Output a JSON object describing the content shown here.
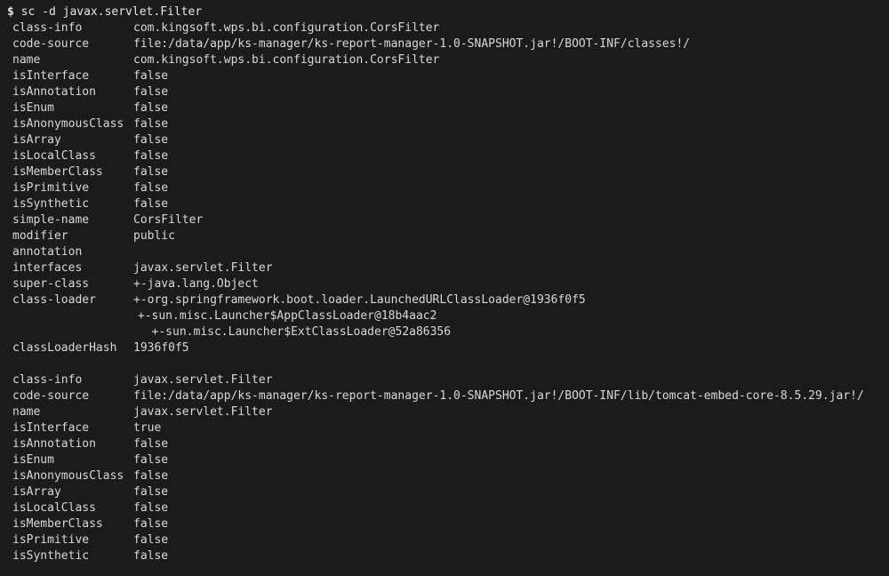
{
  "terminal": {
    "background_color": "#1b1b1b",
    "foreground_color": "#d9d9d9",
    "ghost_line": "                                      ",
    "prompt": {
      "sigil": "$",
      "command": " sc -d javax.servlet.Filter"
    },
    "blocks": [
      {
        "name": "corsfilter-block",
        "rows": [
          {
            "key": "class-info",
            "value": "com.kingsoft.wps.bi.configuration.CorsFilter"
          },
          {
            "key": "code-source",
            "value": "file:/data/app/ks-manager/ks-report-manager-1.0-SNAPSHOT.jar!/BOOT-INF/classes!/"
          },
          {
            "key": "name",
            "value": "com.kingsoft.wps.bi.configuration.CorsFilter"
          },
          {
            "key": "isInterface",
            "value": "false"
          },
          {
            "key": "isAnnotation",
            "value": "false"
          },
          {
            "key": "isEnum",
            "value": "false"
          },
          {
            "key": "isAnonymousClass",
            "value": "false"
          },
          {
            "key": "isArray",
            "value": "false"
          },
          {
            "key": "isLocalClass",
            "value": "false"
          },
          {
            "key": "isMemberClass",
            "value": "false"
          },
          {
            "key": "isPrimitive",
            "value": "false"
          },
          {
            "key": "isSynthetic",
            "value": "false"
          },
          {
            "key": "simple-name",
            "value": "CorsFilter"
          },
          {
            "key": "modifier",
            "value": "public"
          },
          {
            "key": "annotation",
            "value": ""
          },
          {
            "key": "interfaces",
            "value": "javax.servlet.Filter"
          },
          {
            "key": "super-class",
            "value": "+-java.lang.Object"
          },
          {
            "key": "class-loader",
            "value": "+-org.springframework.boot.loader.LaunchedURLClassLoader@1936f0f5"
          }
        ],
        "continuations": [
          "                  +-sun.misc.Launcher$AppClassLoader@18b4aac2",
          "                    +-sun.misc.Launcher$ExtClassLoader@52a86356"
        ],
        "trailing_rows": [
          {
            "key": "classLoaderHash",
            "value": "1936f0f5"
          }
        ]
      },
      {
        "name": "filter-interface-block",
        "rows": [
          {
            "key": "class-info",
            "value": "javax.servlet.Filter"
          },
          {
            "key": "code-source",
            "value": "file:/data/app/ks-manager/ks-report-manager-1.0-SNAPSHOT.jar!/BOOT-INF/lib/tomcat-embed-core-8.5.29.jar!/"
          },
          {
            "key": "name",
            "value": "javax.servlet.Filter"
          },
          {
            "key": "isInterface",
            "value": "true"
          },
          {
            "key": "isAnnotation",
            "value": "false"
          },
          {
            "key": "isEnum",
            "value": "false"
          },
          {
            "key": "isAnonymousClass",
            "value": "false"
          },
          {
            "key": "isArray",
            "value": "false"
          },
          {
            "key": "isLocalClass",
            "value": "false"
          },
          {
            "key": "isMemberClass",
            "value": "false"
          },
          {
            "key": "isPrimitive",
            "value": "false"
          },
          {
            "key": "isSynthetic",
            "value": "false"
          }
        ],
        "continuations": [],
        "trailing_rows": []
      }
    ]
  }
}
